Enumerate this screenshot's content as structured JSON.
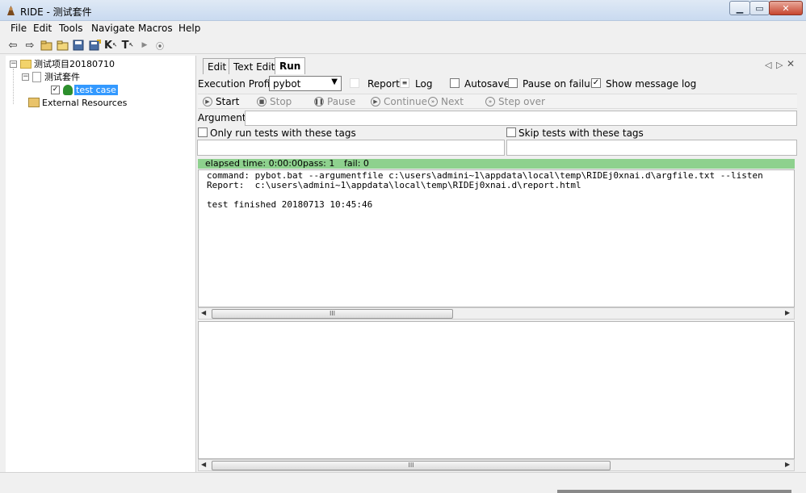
{
  "window": {
    "title": "RIDE - 测试套件"
  },
  "menu": [
    "File",
    "Edit",
    "Tools",
    "Navigate",
    "Macros",
    "Help"
  ],
  "toolbar": {
    "icons": [
      "back-arrow-icon",
      "forward-arrow-icon",
      "open-suite-icon",
      "open-directory-icon",
      "save-icon",
      "save-all-icon",
      "keyword-search-icon",
      "text-search-icon",
      "run-icon",
      "stop-icon"
    ],
    "k_label": "K",
    "t_label": "T"
  },
  "tree": {
    "project": "测试项目20180710",
    "suite": "测试套件",
    "test": "test case",
    "external": "External Resources"
  },
  "tabs": {
    "edit": "Edit",
    "text_edit": "Text Edit",
    "run": "Run"
  },
  "run": {
    "execution_profile_label": "Execution Profile:",
    "execution_profile_value": "pybot",
    "report": "Report",
    "log": "Log",
    "autosave": "Autosave",
    "pause_on_failure": "Pause on failure",
    "show_message_log": "Show message log",
    "buttons": {
      "start": "Start",
      "stop": "Stop",
      "pause": "Pause",
      "continue": "Continue",
      "next": "Next",
      "step_over": "Step over"
    },
    "arguments_label": "Arguments:",
    "only_run_tags": "Only run tests with these tags",
    "skip_tags": "Skip tests with these tags",
    "status": {
      "elapsed": "elapsed time: 0:00:00",
      "pass": "pass: 1",
      "fail": "fail: 0"
    },
    "output_lines": [
      "command: pybot.bat --argumentfile c:\\users\\admini~1\\appdata\\local\\temp\\RIDEj0xnai.d\\argfile.txt --listen",
      "Report:  c:\\users\\admini~1\\appdata\\local\\temp\\RIDEj0xnai.d\\report.html",
      "",
      "test finished 20180713 10:45:46"
    ],
    "scroll_thumb_text": "III"
  }
}
